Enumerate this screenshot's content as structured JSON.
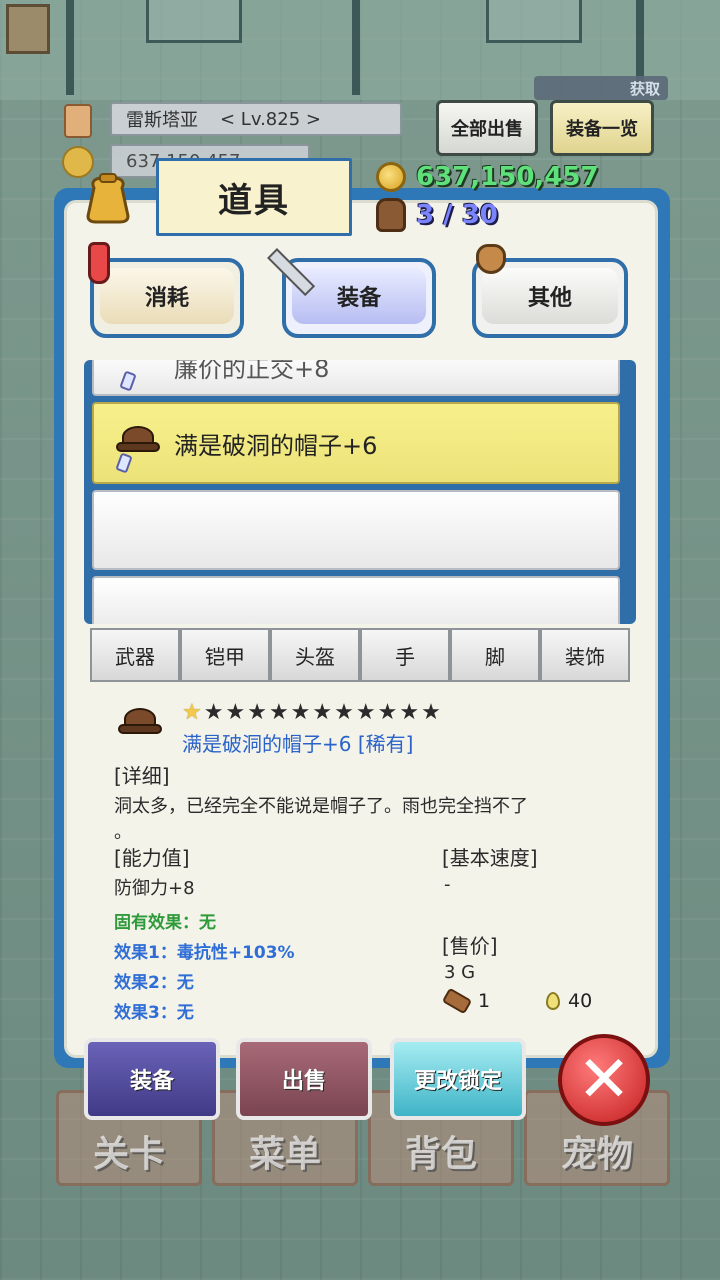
{
  "header": {
    "player_name": "雷斯塔亚",
    "level": "< Lv.825 >",
    "gold_small": "637,150,457",
    "acquire_label": "获取",
    "sell_all": "全部出售",
    "equip_list": "装备一览"
  },
  "panel": {
    "title": "道具",
    "gold": "637,150,457",
    "bag_count": "3 / 30"
  },
  "categories": [
    {
      "label": "消耗",
      "icon": "potion-icon"
    },
    {
      "label": "装备",
      "icon": "sword-icon",
      "selected": true
    },
    {
      "label": "其他",
      "icon": "sack-icon"
    }
  ],
  "list": {
    "items": [
      {
        "label": "廉价的正交+8",
        "partial": true
      },
      {
        "label": "满是破洞的帽子+6",
        "selected": true
      }
    ]
  },
  "subtabs": [
    "武器",
    "铠甲",
    "头盔",
    "手",
    "脚",
    "装饰"
  ],
  "detail": {
    "stars_total": 12,
    "stars_on": 1,
    "name": "满是破洞的帽子+6 [稀有]",
    "detail_heading": "[详细]",
    "description": "洞太多，已经完全不能说是帽子了。雨也完全挡不了",
    "description_tail": "。",
    "ability_heading": "[能力值]",
    "ability_value": "防御力+8",
    "speed_heading": "[基本速度]",
    "speed_value": "-",
    "innate": "固有效果：无",
    "effect1": "效果1：毒抗性+103%",
    "effect2": "效果2：无",
    "effect3": "效果3：无",
    "price_heading": "[售价]",
    "price_value": "3 G",
    "mat1_count": "1",
    "mat2_count": "40"
  },
  "actions": {
    "equip": "装备",
    "sell": "出售",
    "toggle_lock": "更改锁定"
  },
  "nav": [
    "关卡",
    "菜单",
    "背包",
    "宠物"
  ],
  "colors": {
    "panel_blue": "#2f78b8",
    "gold_text": "#5fe07a",
    "bag_text": "#7a84ff",
    "selected_row": "#f7f08a",
    "rarity_blue": "#2b63c9"
  }
}
